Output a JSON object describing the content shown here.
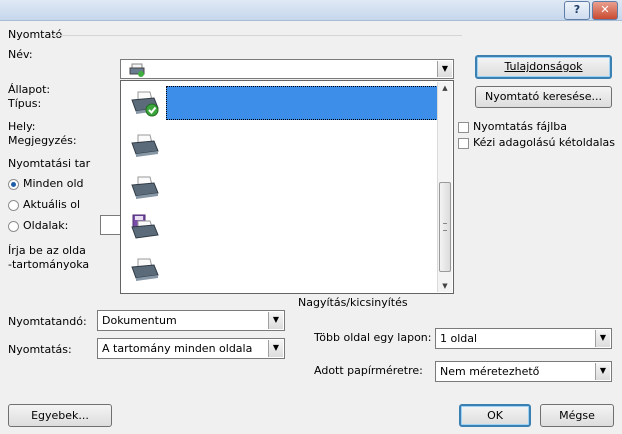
{
  "window": {
    "help_label": "?",
    "close_label": "✕"
  },
  "printer": {
    "group_label": "Nyomtató",
    "name_label": "Név:",
    "status_label": "Állapot:",
    "type_label": "Típus:",
    "where_label": "Hely:",
    "comment_label": "Megjegyzés:",
    "properties_button": "Tulajdonságok",
    "find_printer_button": "Nyomtató keresése...",
    "print_to_file_label": "Nyomtatás fájlba",
    "manual_duplex_label": "Kézi adagolású kétoldalas",
    "print_to_file_checked": false,
    "manual_duplex_checked": false
  },
  "printer_list": {
    "items": [
      {
        "icon": "printer-default-icon",
        "selected": true
      },
      {
        "icon": "printer-icon",
        "selected": false
      },
      {
        "icon": "printer-icon",
        "selected": false
      },
      {
        "icon": "fax-printer-icon",
        "selected": false
      },
      {
        "icon": "printer-icon",
        "selected": false
      }
    ]
  },
  "range": {
    "group_label": "Nyomtatási tar",
    "all_label": "Minden old",
    "current_label": "Aktuális ol",
    "pages_label": "Oldalak:",
    "hint_line1": "Írja be az olda",
    "hint_line2": "-tartományoka",
    "selected": "all"
  },
  "print_what": {
    "label": "Nyomtatandó:",
    "value": "Dokumentum"
  },
  "print_scope": {
    "label": "Nyomtatás:",
    "value": "A tartomány minden oldala"
  },
  "zoom": {
    "group_label": "Nagyítás/kicsinyítés",
    "pages_per_sheet_label": "Több oldal egy lapon:",
    "pages_per_sheet_value": "1 oldal",
    "scale_label": "Adott papírméretre:",
    "scale_value": "Nem méretezhető"
  },
  "footer": {
    "options_button": "Egyebek...",
    "ok_button": "OK",
    "cancel_button": "Mégse"
  },
  "colors": {
    "selection": "#3d8ee8",
    "titlebar": "#c6d7ec",
    "focus": "#3c7fb1"
  }
}
